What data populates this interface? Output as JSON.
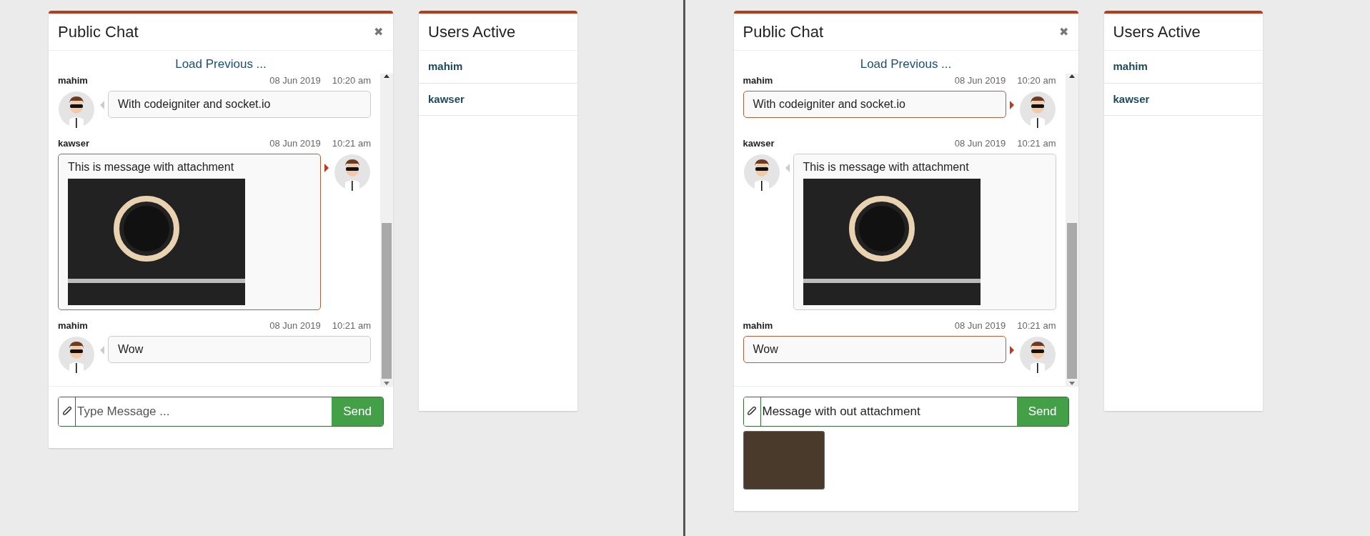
{
  "screens": [
    {
      "chat": {
        "title": "Public Chat",
        "close_label": "✖",
        "load_previous": "Load Previous ...",
        "messages": [
          {
            "sender": "mahim",
            "date": "08 Jun 2019",
            "time": "10:20 am",
            "text": "With codeigniter and socket.io",
            "mine": false,
            "attachment": false
          },
          {
            "sender": "kawser",
            "date": "08 Jun 2019",
            "time": "10:21 am",
            "text": "This is message with attachment",
            "mine": true,
            "attachment": true
          },
          {
            "sender": "mahim",
            "date": "08 Jun 2019",
            "time": "10:21 am",
            "text": "Wow",
            "mine": false,
            "attachment": false
          }
        ],
        "composer": {
          "placeholder": "Type Message ...",
          "send_label": "Send",
          "attachment_preview": false
        }
      },
      "users": {
        "title": "Users Active",
        "names": [
          "mahim",
          "kawser"
        ]
      }
    },
    {
      "chat": {
        "title": "Public Chat",
        "close_label": "✖",
        "load_previous": "Load Previous ...",
        "messages": [
          {
            "sender": "mahim",
            "date": "08 Jun 2019",
            "time": "10:20 am",
            "text": "With codeigniter and socket.io",
            "mine": true,
            "attachment": false
          },
          {
            "sender": "kawser",
            "date": "08 Jun 2019",
            "time": "10:21 am",
            "text": "This is message with attachment",
            "mine": false,
            "attachment": true
          },
          {
            "sender": "mahim",
            "date": "08 Jun 2019",
            "time": "10:21 am",
            "text": "Wow",
            "mine": true,
            "attachment": false
          }
        ],
        "composer": {
          "value": "Message with out attachment",
          "send_label": "Send",
          "attachment_preview": true
        }
      },
      "users": {
        "title": "Users Active",
        "names": [
          "mahim",
          "kawser"
        ]
      }
    }
  ]
}
